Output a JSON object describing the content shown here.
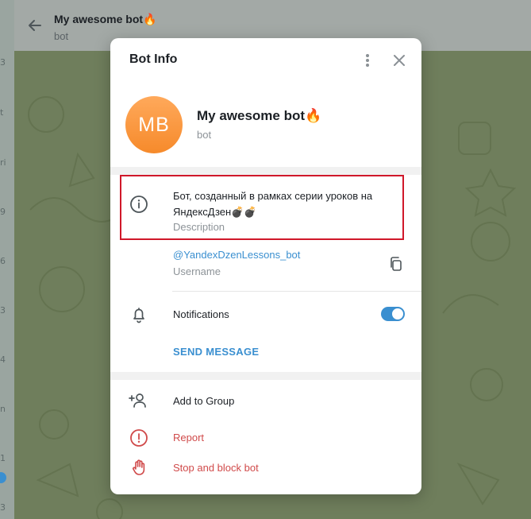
{
  "chat_header": {
    "title": "My awesome bot🔥",
    "subtitle": "bot"
  },
  "left_strip": {
    "marks": [
      "3",
      "t",
      "ri",
      "9",
      "6",
      "3",
      "4",
      "n",
      "1",
      "3"
    ]
  },
  "modal": {
    "title": "Bot Info",
    "avatar_initials": "MB",
    "bot_name": "My awesome bot🔥",
    "bot_kind": "bot",
    "description": "Бот, созданный в рамках серии уроков на ЯндексДзен💣💣",
    "description_label": "Description",
    "username": "@YandexDzenLessons_bot",
    "username_label": "Username",
    "notifications_label": "Notifications",
    "notifications_on": true,
    "send_message_label": "SEND MESSAGE",
    "add_to_group_label": "Add to Group",
    "report_label": "Report",
    "stop_block_label": "Stop and block bot"
  },
  "colors": {
    "accent": "#3a8fd0",
    "danger": "#d04a4a",
    "highlight_border": "#d0182a",
    "avatar_top": "#ffa95b",
    "avatar_bottom": "#f68a2b"
  },
  "icons": {
    "back": "arrow-left-icon",
    "more": "kebab-menu-icon",
    "close": "close-icon",
    "info": "info-icon",
    "copy": "copy-icon",
    "bell": "bell-icon",
    "add_user": "add-user-icon",
    "report": "report-icon",
    "hand": "stop-hand-icon"
  }
}
